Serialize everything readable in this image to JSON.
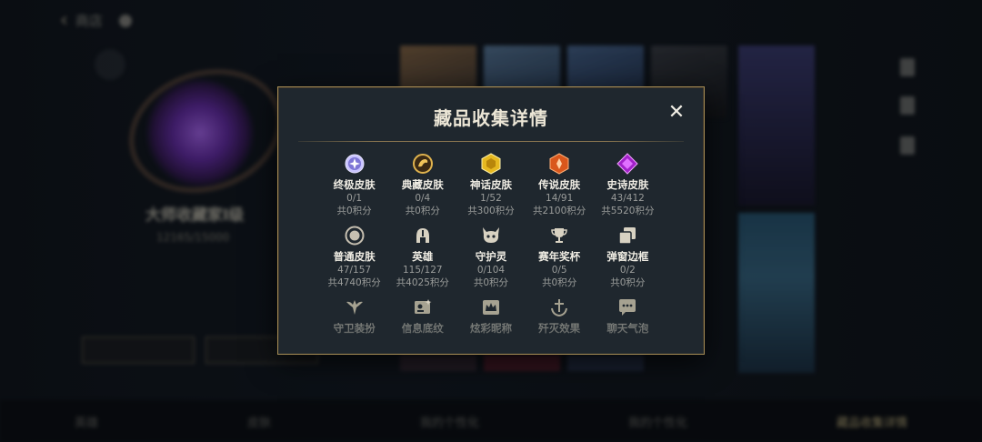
{
  "background": {
    "back_label": "商店",
    "profile_title": "大师收藏家Ⅰ级",
    "profile_sub": "12165/15000",
    "bottom_nav": [
      "英雄",
      "皮肤",
      "我的个性化",
      "我的个性化",
      "藏品收集详情"
    ]
  },
  "modal": {
    "title": "藏品收集详情",
    "close_symbol": "✕",
    "items": [
      {
        "name": "终极皮肤",
        "progress": "0/1",
        "points": "共0积分",
        "icon": "ultimate-skin-icon"
      },
      {
        "name": "典藏皮肤",
        "progress": "0/4",
        "points": "共0积分",
        "icon": "collector-skin-icon"
      },
      {
        "name": "神话皮肤",
        "progress": "1/52",
        "points": "共300积分",
        "icon": "mythic-skin-icon"
      },
      {
        "name": "传说皮肤",
        "progress": "14/91",
        "points": "共2100积分",
        "icon": "legendary-skin-icon"
      },
      {
        "name": "史诗皮肤",
        "progress": "43/412",
        "points": "共5520积分",
        "icon": "epic-skin-icon"
      },
      {
        "name": "普通皮肤",
        "progress": "47/157",
        "points": "共4740积分",
        "icon": "normal-skin-icon"
      },
      {
        "name": "英雄",
        "progress": "115/127",
        "points": "共4025积分",
        "icon": "hero-helmet-icon"
      },
      {
        "name": "守护灵",
        "progress": "0/104",
        "points": "共0积分",
        "icon": "guardian-icon"
      },
      {
        "name": "赛年奖杯",
        "progress": "0/5",
        "points": "共0积分",
        "icon": "trophy-icon"
      },
      {
        "name": "弹窗边框",
        "progress": "0/2",
        "points": "共0积分",
        "icon": "popup-frame-icon"
      },
      {
        "name": "守卫装扮",
        "progress": "",
        "points": "",
        "icon": "ward-skin-icon"
      },
      {
        "name": "信息底纹",
        "progress": "",
        "points": "",
        "icon": "info-background-icon"
      },
      {
        "name": "炫彩昵称",
        "progress": "",
        "points": "",
        "icon": "colorful-name-icon"
      },
      {
        "name": "歼灭效果",
        "progress": "",
        "points": "",
        "icon": "annihilation-effect-icon"
      },
      {
        "name": "聊天气泡",
        "progress": "",
        "points": "",
        "icon": "chat-bubble-icon"
      }
    ]
  },
  "colors": {
    "modal_bg": "#1f272e",
    "modal_border": "#a58c55",
    "title": "#ece6d6",
    "secondary_text": "#9a9c9a"
  }
}
